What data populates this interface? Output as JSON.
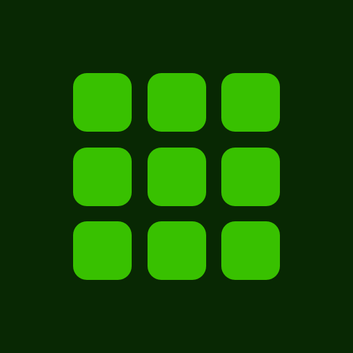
{
  "colors": {
    "background": "#082803",
    "tile": "#38c100"
  },
  "grid": {
    "rows": 3,
    "columns": 3,
    "tile_icon": "rounded-square-tile"
  }
}
